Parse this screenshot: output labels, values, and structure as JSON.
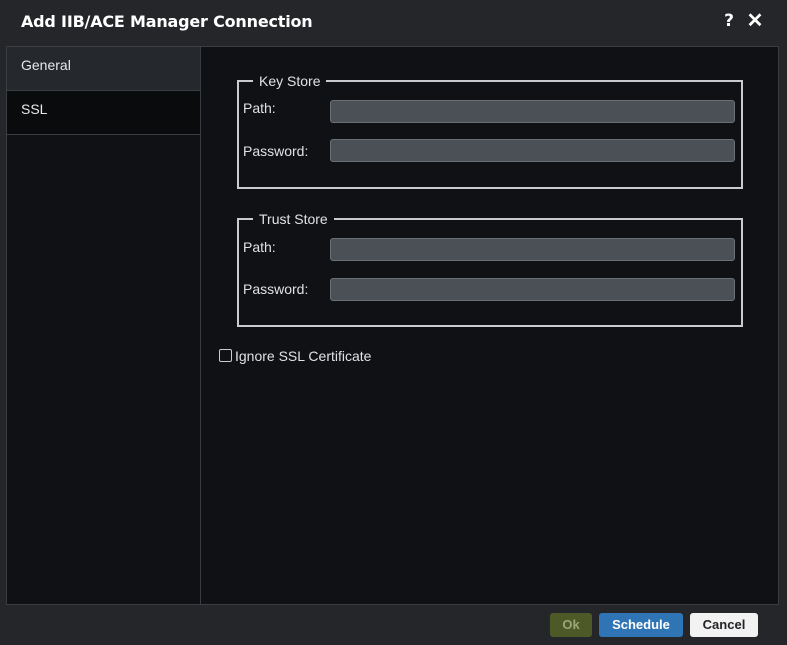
{
  "dialog": {
    "title": "Add IIB/ACE Manager Connection",
    "help_icon": "question-mark-icon",
    "close_icon": "close-icon"
  },
  "sidebar": {
    "items": [
      {
        "label": "General",
        "selected": false
      },
      {
        "label": "SSL",
        "selected": true
      }
    ]
  },
  "key_store": {
    "legend": "Key Store",
    "path_label": "Path:",
    "path_value": "",
    "password_label": "Password:",
    "password_value": ""
  },
  "trust_store": {
    "legend": "Trust Store",
    "path_label": "Path:",
    "path_value": "",
    "password_label": "Password:",
    "password_value": ""
  },
  "ignore_ssl": {
    "label": "Ignore SSL Certificate",
    "checked": false
  },
  "buttons": {
    "ok": "Ok",
    "schedule": "Schedule",
    "cancel": "Cancel"
  },
  "colors": {
    "ok_bg": "#4d5a28",
    "schedule_bg": "#2f74b5",
    "cancel_bg": "#f2f2f2",
    "panel_bg": "#0f1114",
    "input_bg": "#4b5057"
  }
}
